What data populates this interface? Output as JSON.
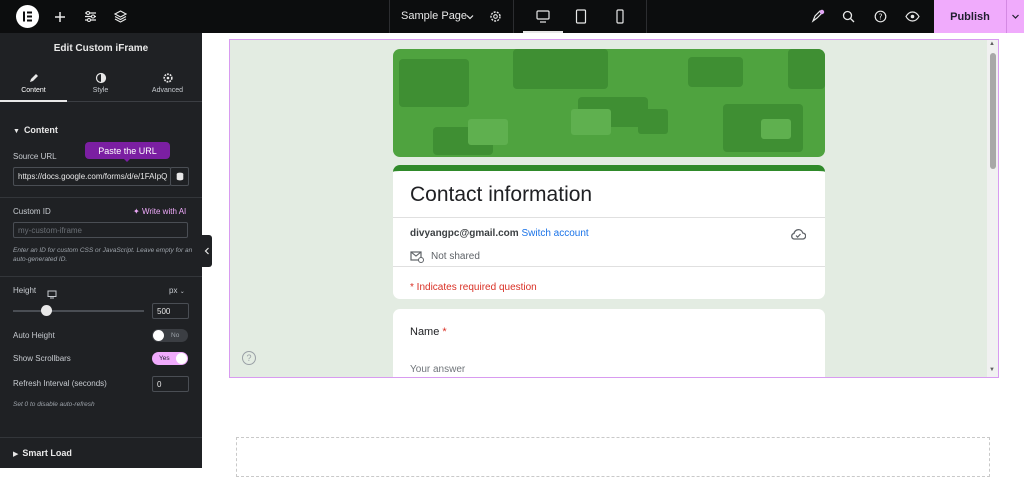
{
  "topbar": {
    "page_title": "Sample Page",
    "publish_label": "Publish"
  },
  "panel": {
    "title": "Edit Custom iFrame",
    "tabs": [
      {
        "label": "Content",
        "icon": "pencil-icon",
        "active": true
      },
      {
        "label": "Style",
        "icon": "contrast-icon",
        "active": false
      },
      {
        "label": "Advanced",
        "icon": "gear-icon",
        "active": false
      }
    ],
    "section_title": "Content",
    "source_url_label": "Source URL",
    "source_url_value": "https://docs.google.com/forms/d/e/1FAIpQ",
    "tooltip": "Paste the URL",
    "custom_id_label": "Custom ID",
    "write_ai_label": "Write with AI",
    "custom_id_placeholder": "my-custom-iframe",
    "custom_id_hint": "Enter an ID for custom CSS or JavaScript. Leave empty for an auto-generated ID.",
    "height_label": "Height",
    "height_unit": "px",
    "height_value": "500",
    "height_slider_fraction": 0.25,
    "auto_height_label": "Auto Height",
    "auto_height_state": "No",
    "show_scrollbars_label": "Show Scrollbars",
    "show_scrollbars_state": "Yes",
    "refresh_label": "Refresh Interval (seconds)",
    "refresh_value": "0",
    "refresh_hint": "Set 0 to disable auto-refresh",
    "smart_load_label": "Smart Load"
  },
  "form": {
    "title": "Contact information",
    "email": "divyangpc@gmail.com",
    "switch_account": "Switch account",
    "not_shared": "Not shared",
    "required_note": "* Indicates required question",
    "question_label": "Name",
    "question_star": "*",
    "answer_placeholder": "Your answer",
    "help": "?"
  },
  "colors": {
    "accent": "#f0abfc",
    "panel_bg": "#1f2124",
    "form_green": "#4fa33f",
    "tooltip": "#7b1fa2"
  }
}
